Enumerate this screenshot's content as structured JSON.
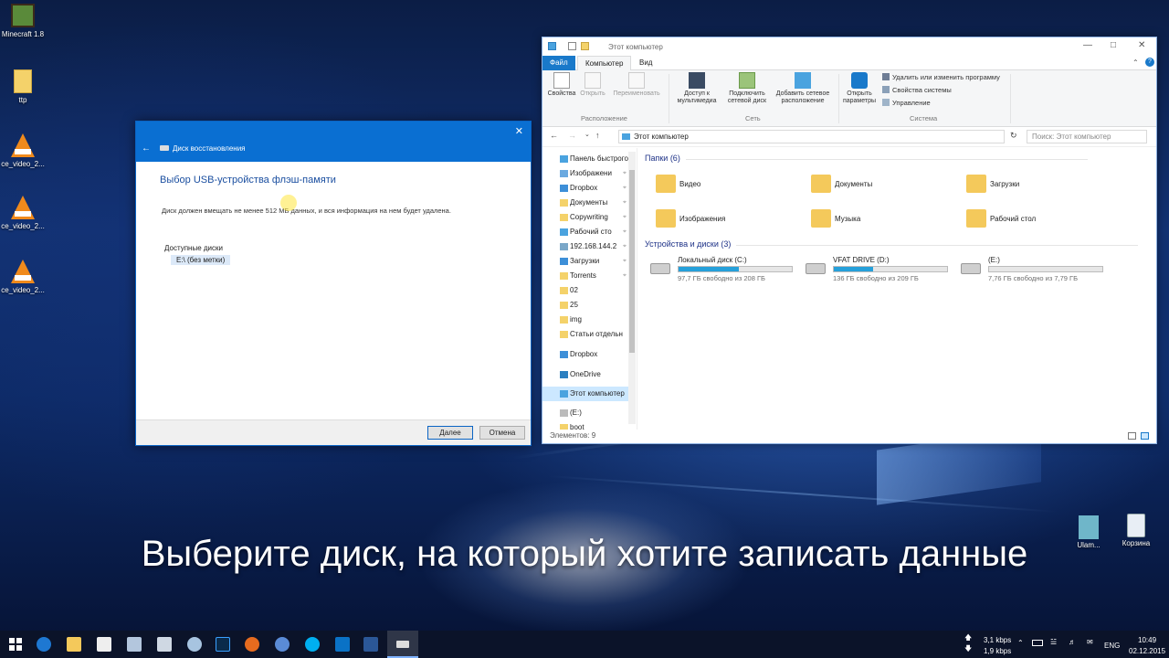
{
  "desktop": {
    "icons": [
      {
        "label": "Minecraft 1.8",
        "icon": "minecraft-icon"
      },
      {
        "label": "ttp",
        "icon": "document-icon"
      },
      {
        "label": "ce_video_2...",
        "icon": "vlc-icon"
      },
      {
        "label": "ce_video_2...",
        "icon": "vlc-icon"
      },
      {
        "label": "ce_video_2...",
        "icon": "vlc-icon"
      }
    ],
    "right_icons": [
      {
        "label": "Ulam...",
        "icon": "folder-icon"
      },
      {
        "label": "Корзина",
        "icon": "recycle-bin-icon"
      }
    ]
  },
  "dialog": {
    "title": "Диск восстановления",
    "heading": "Выбор USB-устройства флэш-памяти",
    "description": "Диск должен вмещать не менее 512 МБ данных, и вся информация на нем будет удалена.",
    "available_label": "Доступные диски",
    "drive_option": "E:\\ (без метки)",
    "next_button": "Далее",
    "cancel_button": "Отмена"
  },
  "explorer": {
    "title": "Этот компьютер",
    "tabs": {
      "file": "Файл",
      "computer": "Компьютер",
      "view": "Вид"
    },
    "ribbon": {
      "properties": "Свойства",
      "open": "Открыть",
      "rename": "Переименовать",
      "group_location": "Расположение",
      "media_access": "Доступ к мультимедиа",
      "map_drive": "Подключить сетевой диск",
      "add_location": "Добавить сетевое расположение",
      "group_network": "Сеть",
      "open_settings": "Открыть параметры",
      "uninstall": "Удалить или изменить программу",
      "system_props": "Свойства системы",
      "manage": "Управление",
      "group_system": "Система"
    },
    "address": "Этот компьютер",
    "search_placeholder": "Поиск: Этот компьютер",
    "nav": [
      {
        "label": "Панель быстрого",
        "pin": false
      },
      {
        "label": "Изображени",
        "pin": true
      },
      {
        "label": "Dropbox",
        "pin": true
      },
      {
        "label": "Документы",
        "pin": true
      },
      {
        "label": "Copywriting",
        "pin": true
      },
      {
        "label": "Рабочий сто",
        "pin": true
      },
      {
        "label": "192.168.144.2",
        "pin": true
      },
      {
        "label": "Загрузки",
        "pin": true
      },
      {
        "label": "Torrents",
        "pin": true
      },
      {
        "label": "02",
        "pin": false
      },
      {
        "label": "25",
        "pin": false
      },
      {
        "label": "img",
        "pin": false
      },
      {
        "label": "Статьи отдельн",
        "pin": false
      },
      {
        "label": "Dropbox",
        "pin": false
      },
      {
        "label": "OneDrive",
        "pin": false
      },
      {
        "label": "Этот компьютер",
        "pin": false
      },
      {
        "label": "(E:)",
        "pin": false
      },
      {
        "label": "boot",
        "pin": false
      }
    ],
    "folders_header": "Папки (6)",
    "folders": [
      {
        "label": "Видео"
      },
      {
        "label": "Документы"
      },
      {
        "label": "Загрузки"
      },
      {
        "label": "Изображения"
      },
      {
        "label": "Музыка"
      },
      {
        "label": "Рабочий стол"
      }
    ],
    "devices_header": "Устройства и диски (3)",
    "drives": [
      {
        "name": "Локальный диск (C:)",
        "free": "97,7 ГБ свободно из 208 ГБ",
        "used_fraction": 0.53
      },
      {
        "name": "VFAT DRIVE (D:)",
        "free": "136 ГБ свободно из 209 ГБ",
        "used_fraction": 0.35
      },
      {
        "name": "(E:)",
        "free": "7,76 ГБ свободно из 7,79 ГБ",
        "used_fraction": 0.0
      }
    ],
    "status": "Элементов: 9"
  },
  "subtitle": "Выберите диск, на который хотите записать данные",
  "taskbar": {
    "net_up": "3,1 kbps",
    "net_down": "1,9 kbps",
    "lang": "ENG",
    "time": "10:49",
    "date": "02.12.2015"
  }
}
